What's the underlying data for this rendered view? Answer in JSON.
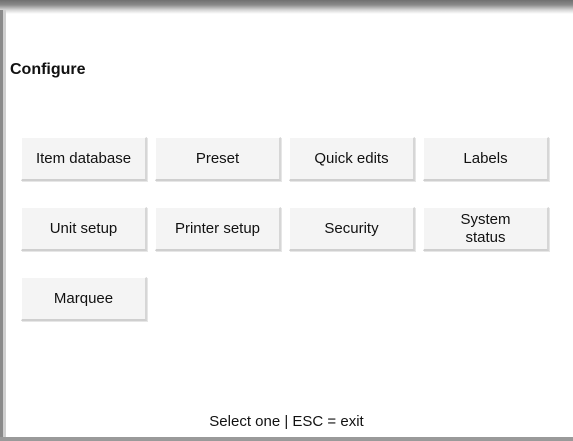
{
  "page": {
    "title": "Configure",
    "status_text": "Select one | ESC = exit"
  },
  "buttons": [
    {
      "label": "Item database"
    },
    {
      "label": "Preset"
    },
    {
      "label": "Quick edits"
    },
    {
      "label": "Labels"
    },
    {
      "label": "Unit setup"
    },
    {
      "label": "Printer setup"
    },
    {
      "label": "Security"
    },
    {
      "label": "System\nstatus"
    },
    {
      "label": "Marquee"
    }
  ]
}
